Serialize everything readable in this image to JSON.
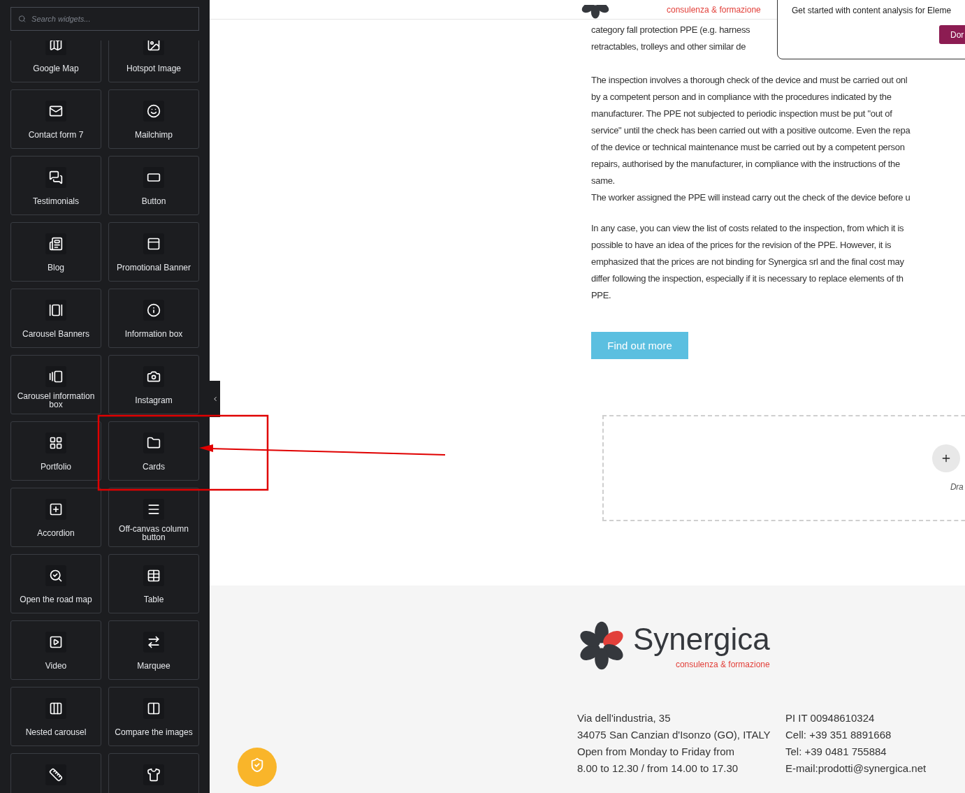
{
  "sidebar": {
    "search": {
      "placeholder": "Search widgets..."
    },
    "widgets": [
      {
        "label": "Google Map"
      },
      {
        "label": "Hotspot Image"
      },
      {
        "label": "Contact form 7"
      },
      {
        "label": "Mailchimp"
      },
      {
        "label": "Testimonials"
      },
      {
        "label": "Button"
      },
      {
        "label": "Blog"
      },
      {
        "label": "Promotional Banner"
      },
      {
        "label": "Carousel Banners"
      },
      {
        "label": "Information box"
      },
      {
        "label": "Carousel information box"
      },
      {
        "label": "Instagram"
      },
      {
        "label": "Portfolio"
      },
      {
        "label": "Cards"
      },
      {
        "label": "Accordion"
      },
      {
        "label": "Off-canvas column button"
      },
      {
        "label": "Open the road map"
      },
      {
        "label": "Table"
      },
      {
        "label": "Video"
      },
      {
        "label": "Marquee"
      },
      {
        "label": "Nested carousel"
      },
      {
        "label": "Compare the images"
      }
    ]
  },
  "header": {
    "tagline": "consulenza & formazione"
  },
  "popup": {
    "text": "Get started with content analysis for Eleme",
    "button": "Dor"
  },
  "article": {
    "paragraphs": [
      [
        "category fall protection PPE (e.g. harness",
        "retractables, trolleys and other similar de"
      ],
      [
        "The inspection involves a thorough check of the device and must be carried out onl",
        "by a competent person and in compliance with the procedures indicated by the",
        "manufacturer. The PPE not subjected to periodic inspection must be put \"out of",
        "service\" until the check has been carried out with a positive outcome. Even the repa",
        "of the device or technical maintenance must be carried out by a competent person",
        "repairs, authorised by the manufacturer, in compliance with the instructions of the",
        "same.",
        "The worker assigned the PPE will instead carry out the check of the device before u"
      ],
      [
        "In any case, you can view the list of costs related to the inspection, from which it is",
        "possible to have an idea of the prices for the revision of the PPE. However, it is",
        "emphasized that the prices are not binding for Synergica srl and the final cost may",
        "differ following the inspection, especially if it is necessary to replace elements of th",
        "PPE."
      ]
    ],
    "button": "Find out more"
  },
  "drop_zone": {
    "hint": "Dra"
  },
  "footer": {
    "brand": "Synergica",
    "tagline": "consulenza & formazione",
    "columns": [
      [
        "Via dell'industria, 35",
        "34075 San Canzian d'Isonzo (GO), ITALY",
        "Open from Monday to Friday from",
        "8.00 to 12.30 / from 14.00 to 17.30"
      ],
      [
        "PI IT 00948610324",
        "Cell: +39 351 8891668",
        "Tel: +39 0481 755884",
        "E-mail:prodotti@synergica.net"
      ]
    ]
  }
}
